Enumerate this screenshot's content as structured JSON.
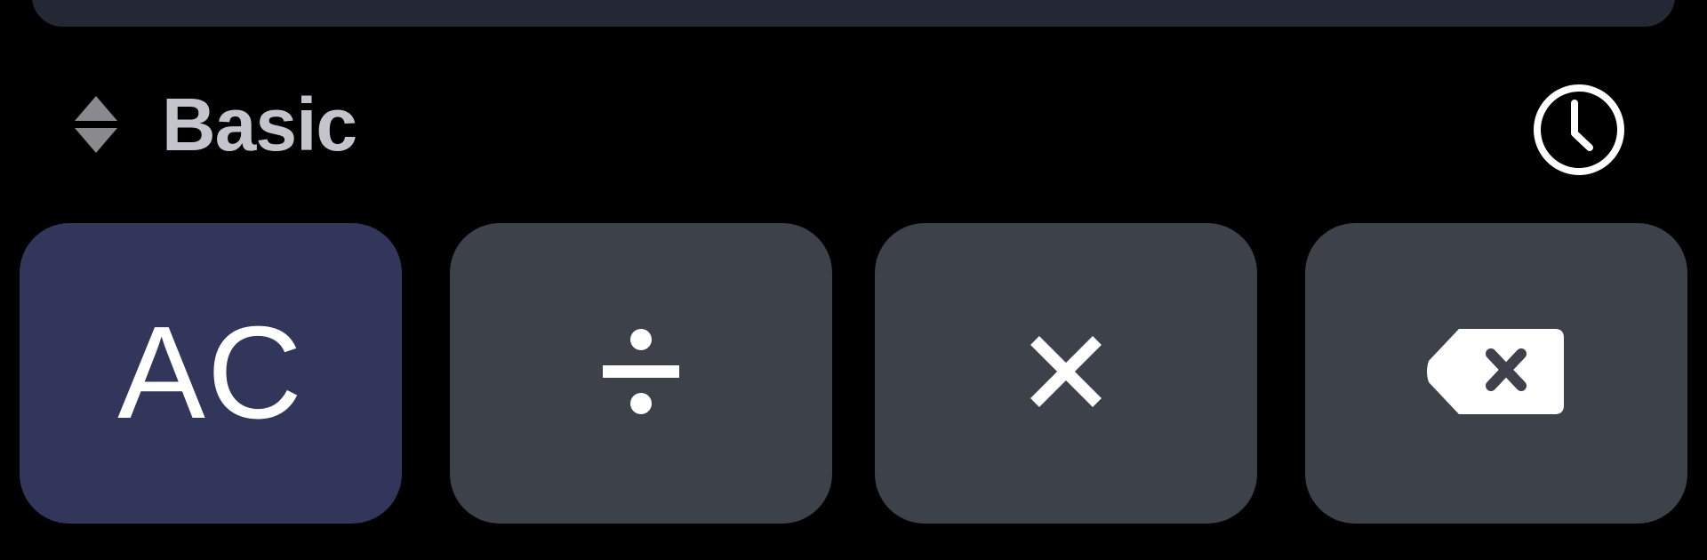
{
  "mode": {
    "label": "Basic",
    "icon": "sort-arrows-icon"
  },
  "history": {
    "icon": "clock-icon"
  },
  "keys": [
    {
      "id": "all-clear",
      "label": "AC",
      "icon": "",
      "color": "#32365a"
    },
    {
      "id": "divide",
      "label": "÷",
      "icon": "divide-icon",
      "color": "#3d414a"
    },
    {
      "id": "multiply",
      "label": "×",
      "icon": "multiply-icon",
      "color": "#3d414a"
    },
    {
      "id": "backspace",
      "label": "",
      "icon": "backspace-icon",
      "color": "#3d414a"
    }
  ],
  "colors": {
    "background": "#000000",
    "display_panel": "#242834",
    "accent_key": "#32365a",
    "operator_key": "#3d414a",
    "mode_text": "#c4c4cc",
    "icon_gray": "#8a8a8e",
    "foreground": "#ffffff"
  }
}
